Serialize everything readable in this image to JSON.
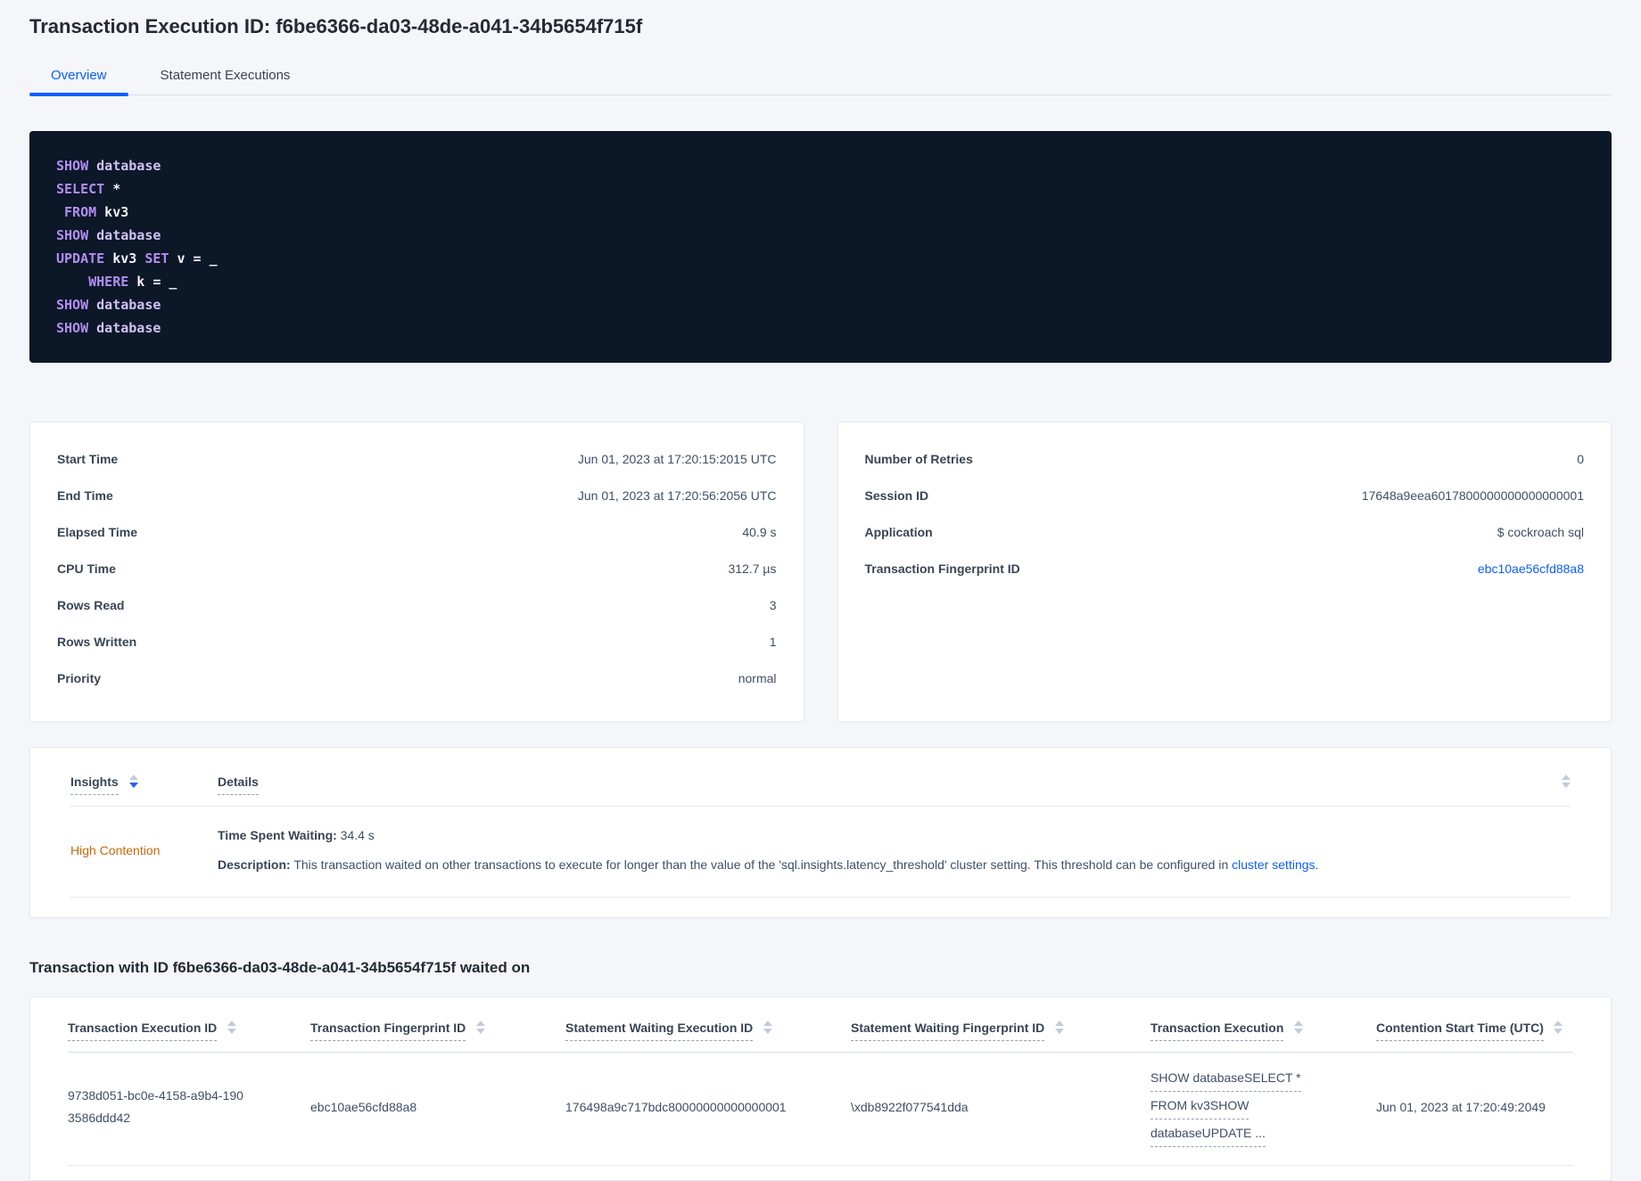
{
  "page": {
    "title": "Transaction Execution ID: f6be6366-da03-48de-a041-34b5654f715f"
  },
  "tabs": {
    "overview": "Overview",
    "statement_executions": "Statement Executions"
  },
  "code": {
    "lines": [
      [
        {
          "t": "SHOW",
          "c": "kw"
        },
        {
          "t": " ",
          "c": "pl"
        },
        {
          "t": "database",
          "c": "kw2"
        }
      ],
      [
        {
          "t": "SELECT",
          "c": "kw"
        },
        {
          "t": " *",
          "c": "pl"
        }
      ],
      [
        {
          "t": " FROM",
          "c": "kw"
        },
        {
          "t": " kv3",
          "c": "pl"
        }
      ],
      [
        {
          "t": "SHOW",
          "c": "kw"
        },
        {
          "t": " ",
          "c": "pl"
        },
        {
          "t": "database",
          "c": "kw2"
        }
      ],
      [
        {
          "t": "UPDATE",
          "c": "kw"
        },
        {
          "t": " kv3 ",
          "c": "pl"
        },
        {
          "t": "SET",
          "c": "kw"
        },
        {
          "t": " v = _",
          "c": "pl"
        }
      ],
      [
        {
          "t": "    WHERE",
          "c": "kw"
        },
        {
          "t": " k = _",
          "c": "pl"
        }
      ],
      [
        {
          "t": "SHOW",
          "c": "kw"
        },
        {
          "t": " ",
          "c": "pl"
        },
        {
          "t": "database",
          "c": "kw2"
        }
      ],
      [
        {
          "t": "SHOW",
          "c": "kw"
        },
        {
          "t": " ",
          "c": "pl"
        },
        {
          "t": "database",
          "c": "kw2"
        }
      ]
    ]
  },
  "stats_left": {
    "rows": [
      {
        "label": "Start Time",
        "value": "Jun 01, 2023 at 17:20:15:2015 UTC"
      },
      {
        "label": "End Time",
        "value": "Jun 01, 2023 at 17:20:56:2056 UTC"
      },
      {
        "label": "Elapsed Time",
        "value": "40.9 s"
      },
      {
        "label": "CPU Time",
        "value": "312.7 µs"
      },
      {
        "label": "Rows Read",
        "value": "3"
      },
      {
        "label": "Rows Written",
        "value": "1"
      },
      {
        "label": "Priority",
        "value": "normal"
      }
    ]
  },
  "stats_right": {
    "rows": [
      {
        "label": "Number of Retries",
        "value": "0"
      },
      {
        "label": "Session ID",
        "value": "17648a9eea6017800000000000000001"
      },
      {
        "label": "Application",
        "value": "$ cockroach sql"
      },
      {
        "label": "Transaction Fingerprint ID",
        "value": "ebc10ae56cfd88a8"
      }
    ]
  },
  "insights": {
    "header_insights": "Insights",
    "header_details": "Details",
    "row": {
      "insight": "High Contention",
      "waiting_label": "Time Spent Waiting:",
      "waiting_value": " 34.4 s",
      "description_label": "Description:",
      "description_text": " This transaction waited on other transactions to execute for longer than the value of the 'sql.insights.latency_threshold' cluster setting. This threshold can be configured in ",
      "description_link": "cluster settings",
      "description_suffix": "."
    }
  },
  "waited": {
    "heading": "Transaction with ID f6be6366-da03-48de-a041-34b5654f715f waited on",
    "columns": [
      "Transaction Execution ID",
      "Transaction Fingerprint ID",
      "Statement Waiting Execution ID",
      "Statement Waiting Fingerprint ID",
      "Transaction Execution",
      "Contention Start Time (UTC)"
    ],
    "row": {
      "txn_execution_id": "9738d051-bc0e-4158-a9b4-1903586ddd42",
      "txn_fingerprint_id": "ebc10ae56cfd88a8",
      "stmt_waiting_execution_id": "176498a9c717bdc80000000000000001",
      "stmt_waiting_fingerprint_id": "\\xdb8922f077541dda",
      "txn_execution_lines": [
        "SHOW databaseSELECT *",
        "FROM kv3SHOW",
        "databaseUPDATE ..."
      ],
      "contention_start": "Jun 01, 2023 at 17:20:49:2049"
    }
  },
  "colors": {
    "accent_blue": "#0b5dff",
    "insight_orange": "#c66809",
    "code_background": "#0c1728",
    "code_keyword": "#b28df0",
    "page_background": "#f4f6fa"
  }
}
